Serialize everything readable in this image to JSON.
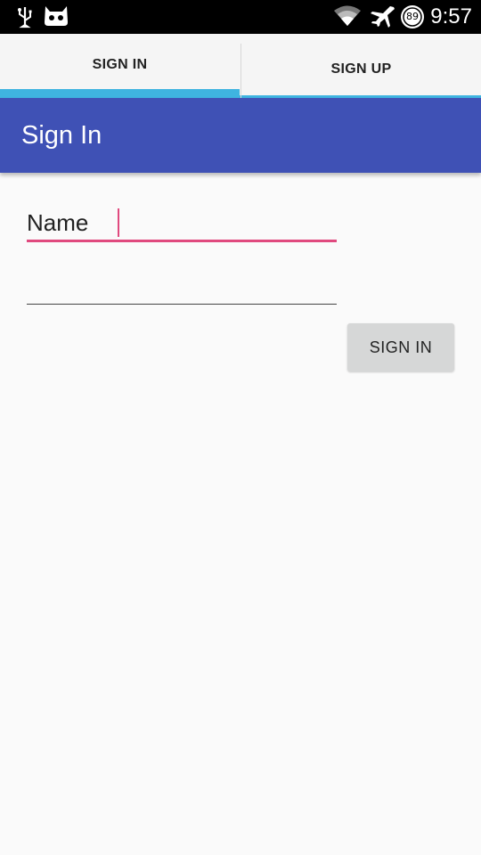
{
  "status_bar": {
    "time": "9:57",
    "battery_level": "89",
    "icons": [
      "usb-icon",
      "cyanogenmod-icon",
      "wifi-icon",
      "airplane-icon",
      "battery-icon"
    ]
  },
  "tabs": [
    {
      "label": "SIGN IN",
      "selected": true
    },
    {
      "label": "SIGN UP",
      "selected": false
    }
  ],
  "app_bar": {
    "title": "Sign In"
  },
  "form": {
    "name_value": "Name",
    "second_value": "",
    "submit_label": "SIGN IN"
  },
  "colors": {
    "app_bar": "#3f51b5",
    "tab_indicator": "#3fb4e0",
    "accent": "#e0497e",
    "button": "#d6d7d7"
  }
}
